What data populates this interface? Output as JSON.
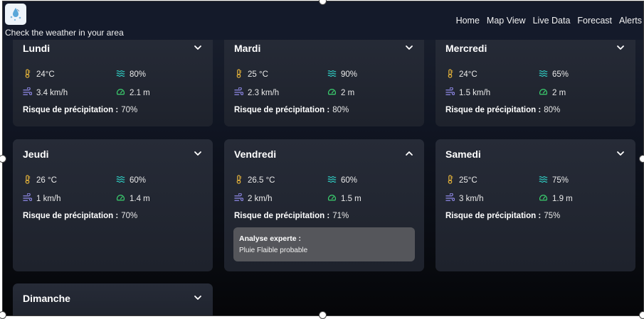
{
  "header": {
    "tagline": "Check the weather in your area",
    "nav": [
      "Home",
      "Map View",
      "Live Data",
      "Forecast",
      "Alerts"
    ]
  },
  "labels": {
    "risk": "Risque de précipitation :",
    "expert_title": "Analyse experte :"
  },
  "colors": {
    "temp_icon": "#e6b43a",
    "humidity_icon": "#2fc9bf",
    "wind_icon": "#8e88e6",
    "gauge_icon": "#3bd16f"
  },
  "days": [
    {
      "name": "Lundi",
      "temp": "24°C",
      "humidity": "80%",
      "wind": "3.4 km/h",
      "visibility": "2.1 m",
      "risk": "70%",
      "expanded": false
    },
    {
      "name": "Mardi",
      "temp": "25 °C",
      "humidity": "90%",
      "wind": "2.3 km/h",
      "visibility": "2 m",
      "risk": "80%",
      "expanded": false
    },
    {
      "name": "Mercredi",
      "temp": "24°C",
      "humidity": "65%",
      "wind": "1.5 km/h",
      "visibility": "2 m",
      "risk": "80%",
      "expanded": false
    },
    {
      "name": "Jeudi",
      "temp": "26 °C",
      "humidity": "60%",
      "wind": "1 km/h",
      "visibility": "1.4 m",
      "risk": "70%",
      "expanded": false
    },
    {
      "name": "Vendredi",
      "temp": "26.5 °C",
      "humidity": "60%",
      "wind": "2 km/h",
      "visibility": "1.5 m",
      "risk": "71%",
      "expanded": true,
      "analysis": "Pluie Flaible probable"
    },
    {
      "name": "Samedi",
      "temp": "25°C",
      "humidity": "75%",
      "wind": "3 km/h",
      "visibility": "1.9 m",
      "risk": "75%",
      "expanded": false
    },
    {
      "name": "Dimanche",
      "expanded": false
    }
  ]
}
